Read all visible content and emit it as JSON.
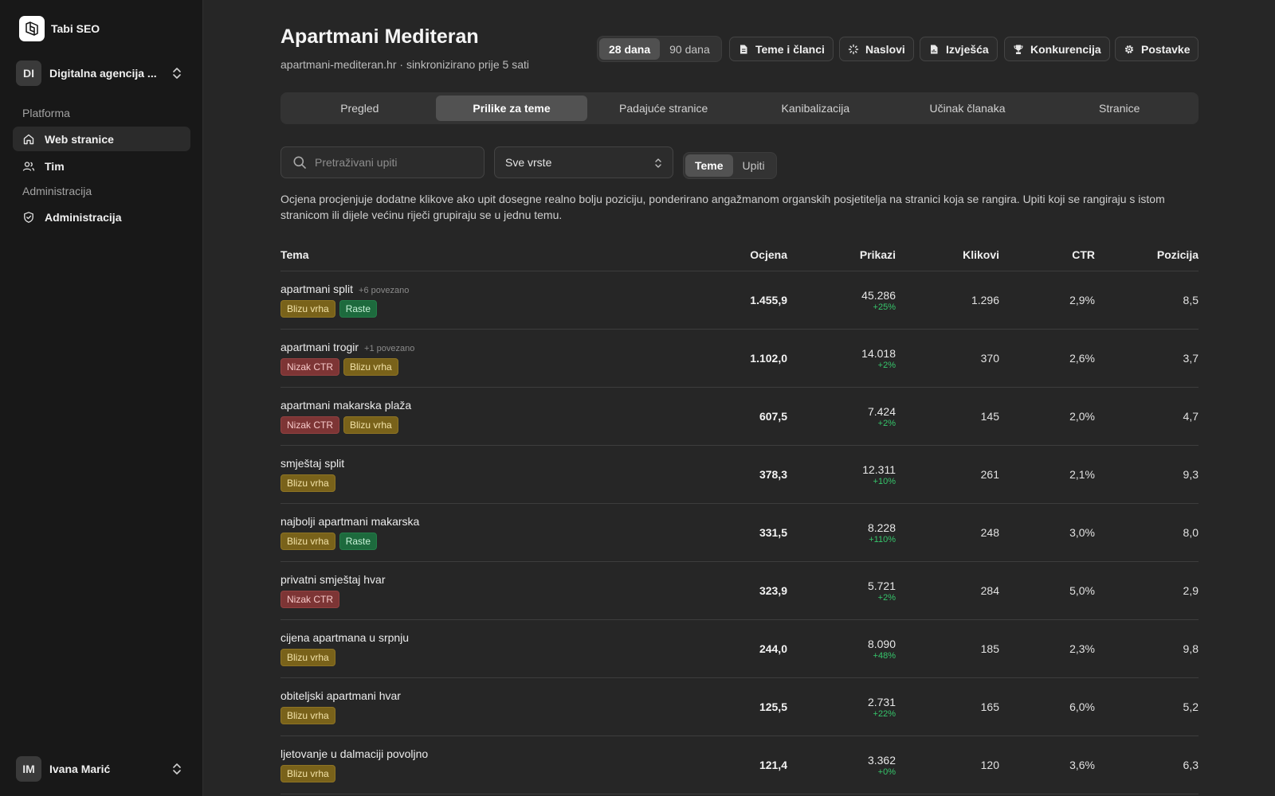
{
  "app": {
    "name": "Tabi SEO"
  },
  "sidebar": {
    "team": {
      "initials": "DI",
      "name": "Digitalna agencija ..."
    },
    "sections": [
      {
        "label": "Platforma",
        "items": [
          {
            "label": "Web stranice",
            "icon": "home-icon",
            "active": true
          },
          {
            "label": "Tim",
            "icon": "users-icon",
            "active": false
          }
        ]
      },
      {
        "label": "Administracija",
        "items": [
          {
            "label": "Administracija",
            "icon": "shield-icon",
            "active": false
          }
        ]
      }
    ],
    "user": {
      "initials": "IM",
      "name": "Ivana Marić"
    }
  },
  "header": {
    "title": "Apartmani Mediteran",
    "subtitle": "apartmani-mediteran.hr · sinkronizirano prije 5 sati",
    "ranges": [
      {
        "label": "28 dana",
        "active": true
      },
      {
        "label": "90 dana",
        "active": false
      }
    ],
    "actions": [
      {
        "label": "Teme i članci",
        "icon": "document-icon"
      },
      {
        "label": "Naslovi",
        "icon": "sparkle-icon"
      },
      {
        "label": "Izvješća",
        "icon": "report-icon"
      },
      {
        "label": "Konkurencija",
        "icon": "trophy-icon"
      },
      {
        "label": "Postavke",
        "icon": "gear-icon"
      }
    ]
  },
  "tabs": [
    {
      "label": "Pregled",
      "active": false
    },
    {
      "label": "Prilike za teme",
      "active": true
    },
    {
      "label": "Padajuće stranice",
      "active": false
    },
    {
      "label": "Kanibalizacija",
      "active": false
    },
    {
      "label": "Učinak članaka",
      "active": false
    },
    {
      "label": "Stranice",
      "active": false
    }
  ],
  "filters": {
    "search_placeholder": "Pretraživani upiti",
    "type_select": "Sve vrste",
    "view": [
      {
        "label": "Teme",
        "active": true
      },
      {
        "label": "Upiti",
        "active": false
      }
    ]
  },
  "description": "Ocjena procjenjuje dodatne klikove ako upit dosegne realno bolju poziciju, ponderirano angažmanom organskih posjetitelja na stranici koja se rangira. Upiti koji se rangiraju s istom stranicom ili dijele većinu riječi grupiraju se u jednu temu.",
  "table": {
    "columns": {
      "topic": "Tema",
      "score": "Ocjena",
      "impressions": "Prikazi",
      "clicks": "Klikovi",
      "ctr": "CTR",
      "position": "Pozicija"
    },
    "rows": [
      {
        "topic": "apartmani split",
        "related": "+6 povezano",
        "tags": [
          {
            "label": "Blizu vrha",
            "kind": "near"
          },
          {
            "label": "Raste",
            "kind": "rise"
          }
        ],
        "score": "1.455,9",
        "impressions": "45.286",
        "delta": "+25%",
        "clicks": "1.296",
        "ctr": "2,9%",
        "position": "8,5"
      },
      {
        "topic": "apartmani trogir",
        "related": "+1 povezano",
        "tags": [
          {
            "label": "Nizak CTR",
            "kind": "low"
          },
          {
            "label": "Blizu vrha",
            "kind": "near"
          }
        ],
        "score": "1.102,0",
        "impressions": "14.018",
        "delta": "+2%",
        "clicks": "370",
        "ctr": "2,6%",
        "position": "3,7"
      },
      {
        "topic": "apartmani makarska plaža",
        "related": "",
        "tags": [
          {
            "label": "Nizak CTR",
            "kind": "low"
          },
          {
            "label": "Blizu vrha",
            "kind": "near"
          }
        ],
        "score": "607,5",
        "impressions": "7.424",
        "delta": "+2%",
        "clicks": "145",
        "ctr": "2,0%",
        "position": "4,7"
      },
      {
        "topic": "smještaj split",
        "related": "",
        "tags": [
          {
            "label": "Blizu vrha",
            "kind": "near"
          }
        ],
        "score": "378,3",
        "impressions": "12.311",
        "delta": "+10%",
        "clicks": "261",
        "ctr": "2,1%",
        "position": "9,3"
      },
      {
        "topic": "najbolji apartmani makarska",
        "related": "",
        "tags": [
          {
            "label": "Blizu vrha",
            "kind": "near"
          },
          {
            "label": "Raste",
            "kind": "rise"
          }
        ],
        "score": "331,5",
        "impressions": "8.228",
        "delta": "+110%",
        "clicks": "248",
        "ctr": "3,0%",
        "position": "8,0"
      },
      {
        "topic": "privatni smještaj hvar",
        "related": "",
        "tags": [
          {
            "label": "Nizak CTR",
            "kind": "low"
          }
        ],
        "score": "323,9",
        "impressions": "5.721",
        "delta": "+2%",
        "clicks": "284",
        "ctr": "5,0%",
        "position": "2,9"
      },
      {
        "topic": "cijena apartmana u srpnju",
        "related": "",
        "tags": [
          {
            "label": "Blizu vrha",
            "kind": "near"
          }
        ],
        "score": "244,0",
        "impressions": "8.090",
        "delta": "+48%",
        "clicks": "185",
        "ctr": "2,3%",
        "position": "9,8"
      },
      {
        "topic": "obiteljski apartmani hvar",
        "related": "",
        "tags": [
          {
            "label": "Blizu vrha",
            "kind": "near"
          }
        ],
        "score": "125,5",
        "impressions": "2.731",
        "delta": "+22%",
        "clicks": "165",
        "ctr": "6,0%",
        "position": "5,2"
      },
      {
        "topic": "ljetovanje u dalmaciji povoljno",
        "related": "",
        "tags": [
          {
            "label": "Blizu vrha",
            "kind": "near"
          }
        ],
        "score": "121,4",
        "impressions": "3.362",
        "delta": "+0%",
        "clicks": "120",
        "ctr": "3,6%",
        "position": "6,3"
      }
    ]
  }
}
